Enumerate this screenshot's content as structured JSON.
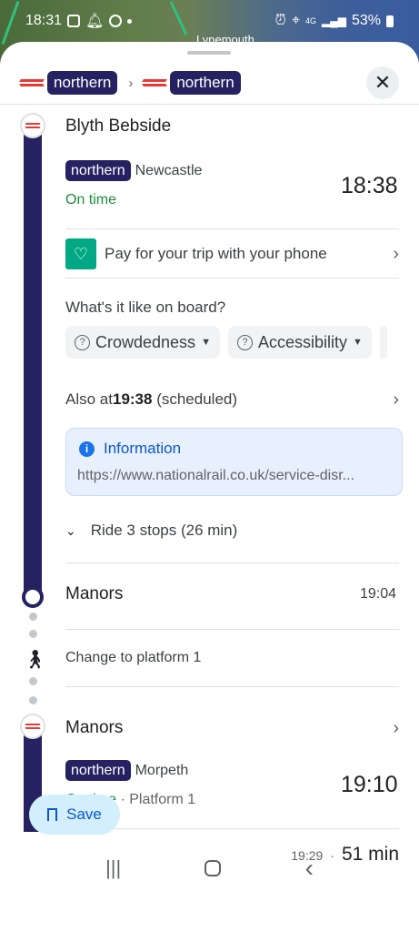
{
  "status_bar": {
    "time": "18:31",
    "battery": "53%",
    "network": "4G"
  },
  "map": {
    "place_label": "Lynemouth"
  },
  "header": {
    "operators": [
      "northern",
      "northern"
    ],
    "separator": "›",
    "close_icon": "close-icon"
  },
  "first_leg": {
    "origin": "Blyth Bebside",
    "route_badge": "northern",
    "destination": "Newcastle",
    "status": "On time",
    "depart_time": "18:38",
    "pay_text": "Pay for your trip with your phone",
    "onboard_question": "What's it like on board?",
    "chips": [
      "Crowdedness",
      "Accessibility"
    ],
    "also_at_prefix": "Also at ",
    "also_at_time": "19:38",
    "also_at_suffix": " (scheduled)",
    "info_title": "Information",
    "info_url": "https://www.nationalrail.co.uk/service-disr...",
    "ride_text": "Ride 3 stops (26 min)",
    "arrival_stop": "Manors",
    "arrival_time": "19:04"
  },
  "transfer": {
    "text": "Change to platform 1"
  },
  "second_leg": {
    "origin": "Manors",
    "route_badge": "northern",
    "destination": "Morpeth",
    "status": "On time",
    "platform": " · Platform 1",
    "depart_time": "19:10"
  },
  "footer": {
    "save_label": "Save",
    "arrive_time": "19:29",
    "dot": "·",
    "duration": "51 min"
  },
  "nav": {
    "recent": "|||",
    "home": "home",
    "back": "‹"
  },
  "colors": {
    "northern": "#262262",
    "on_time": "#1e8e3e",
    "accent": "#0b57d0"
  }
}
